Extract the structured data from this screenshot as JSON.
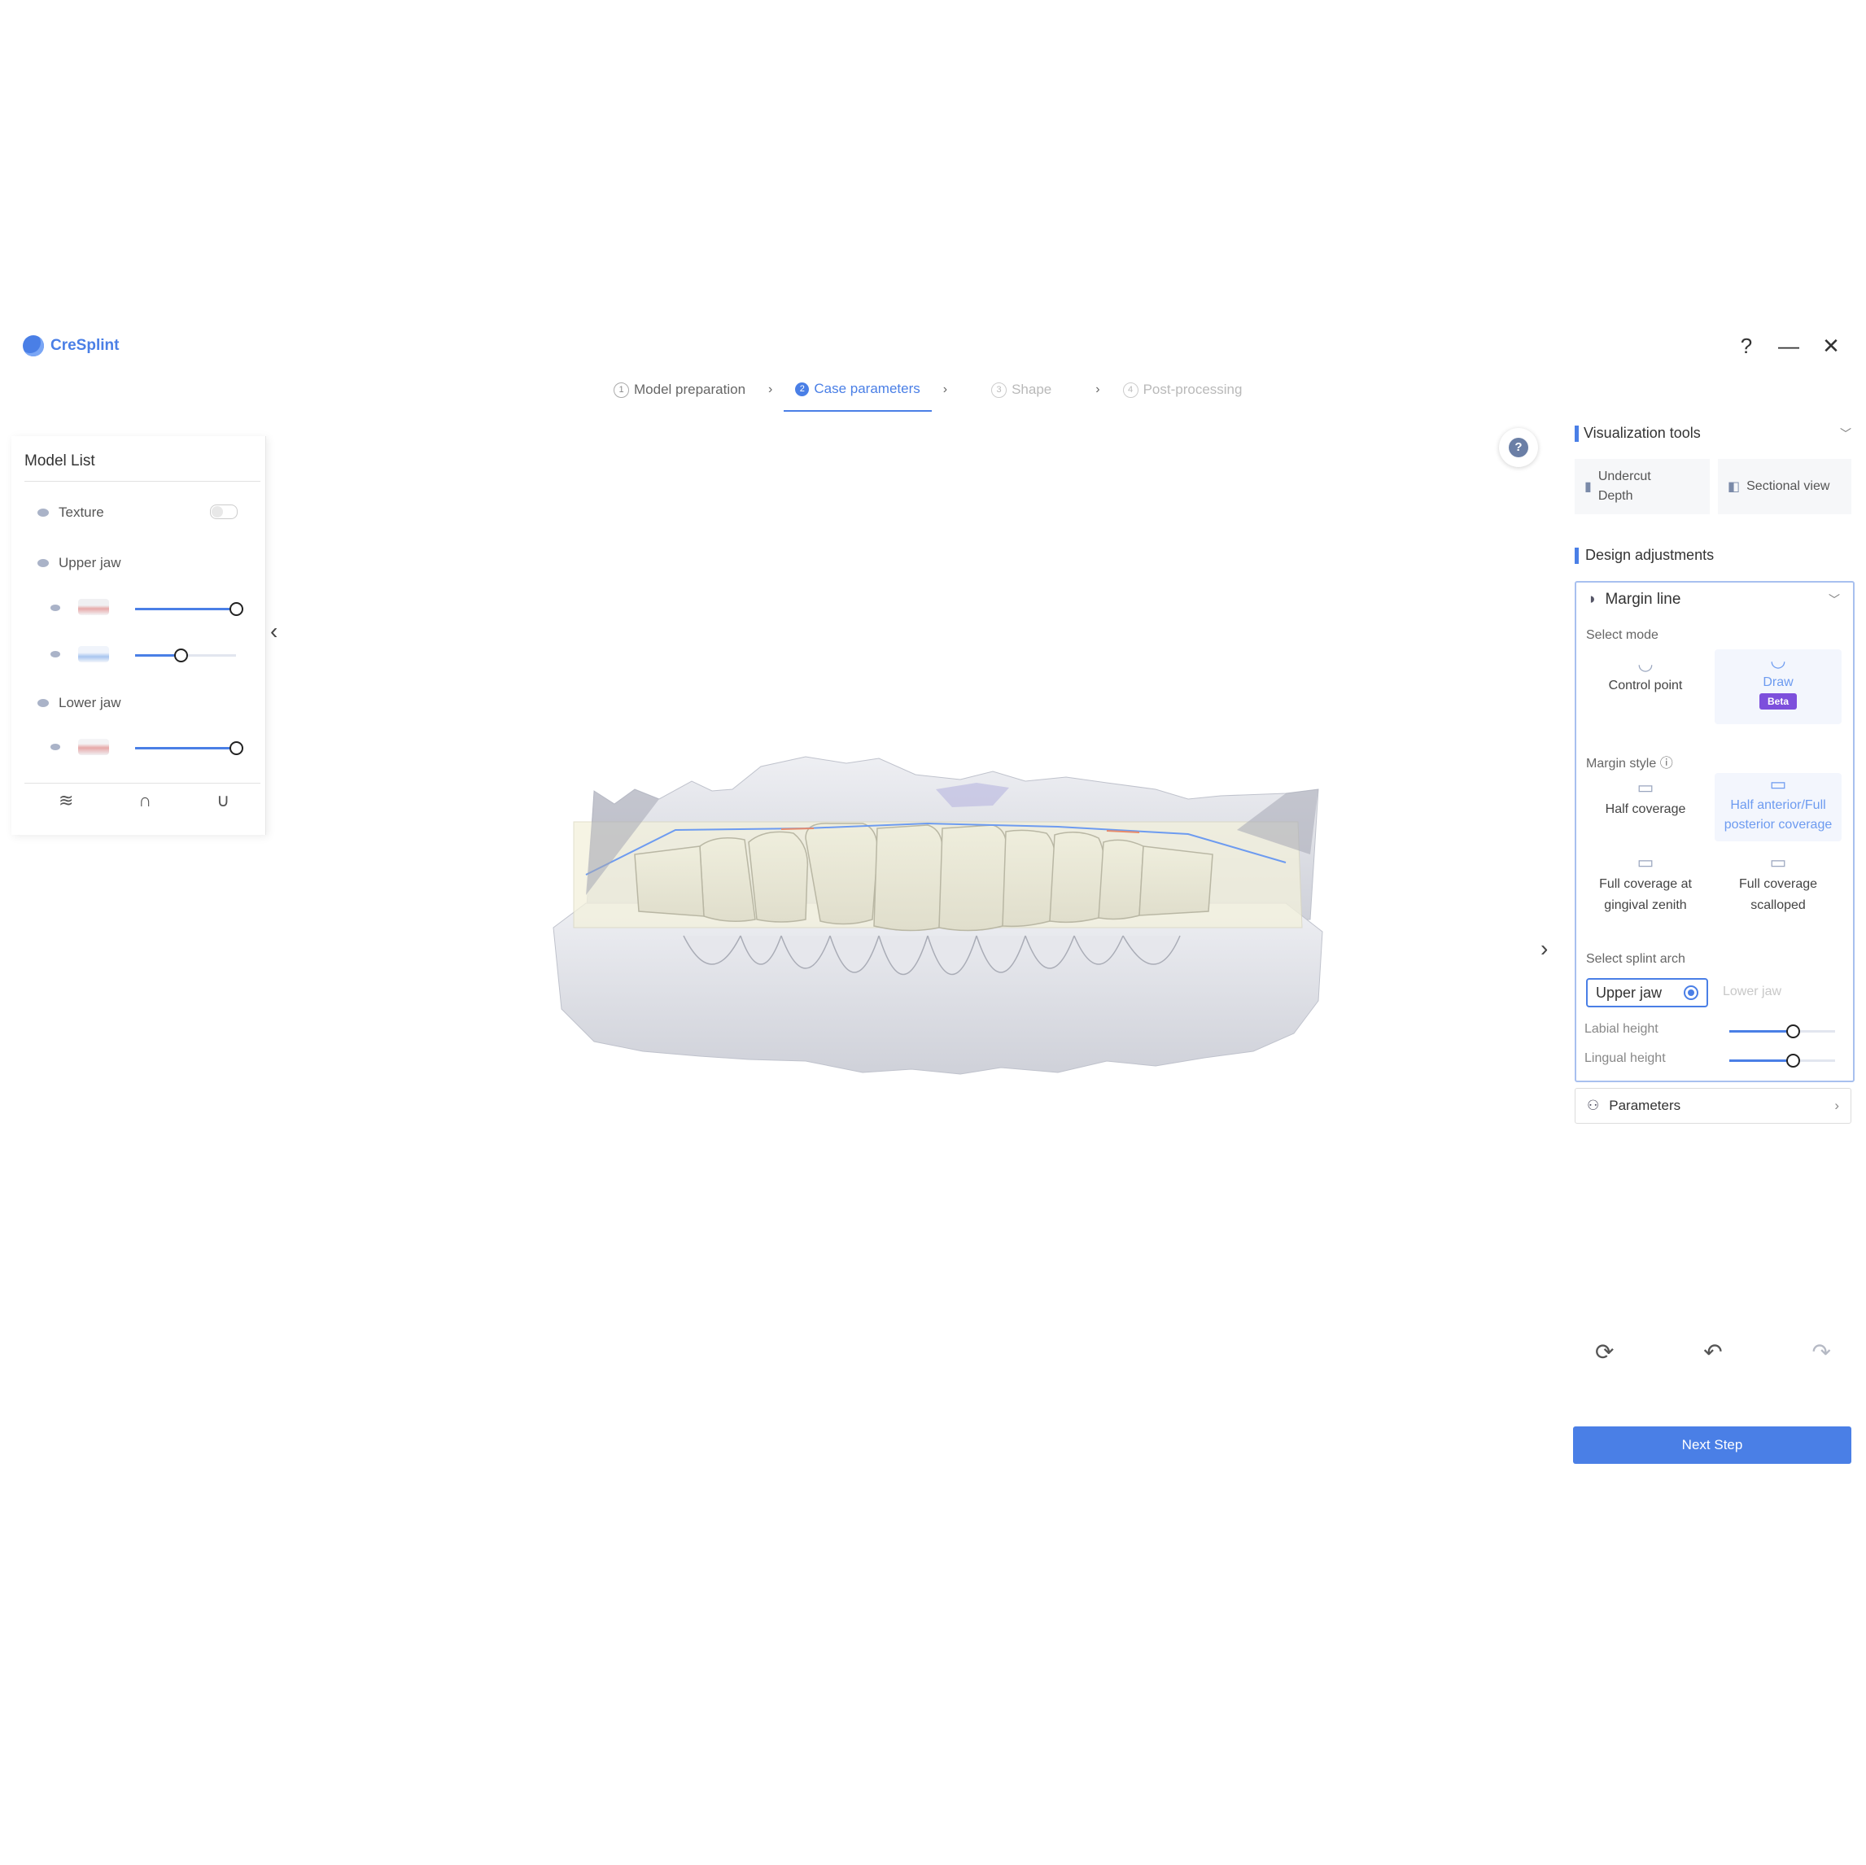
{
  "app": {
    "name": "CreSplint",
    "logo_icon": "logo-icon"
  },
  "window": {
    "help": "?",
    "minimize": "—",
    "close": "✕"
  },
  "steps": [
    {
      "num": "1",
      "label": "Model preparation",
      "state": "done"
    },
    {
      "num": "2",
      "label": "Case parameters",
      "state": "active"
    },
    {
      "num": "3",
      "label": "Shape",
      "state": "future"
    },
    {
      "num": "4",
      "label": "Post-processing",
      "state": "future"
    }
  ],
  "model_list": {
    "title": "Model List",
    "texture_label": "Texture",
    "texture_on": false,
    "upper_jaw_label": "Upper jaw",
    "lower_jaw_label": "Lower jaw",
    "upper_layers": [
      {
        "opacity": 1.0
      },
      {
        "opacity": 0.45
      }
    ],
    "lower_layers": [
      {
        "opacity": 1.0
      }
    ],
    "view_icons": [
      "occlusal-view-icon",
      "upper-arch-icon",
      "lower-arch-icon"
    ]
  },
  "visualization": {
    "title": "Visualization tools",
    "undercut_label": "Undercut\nDepth",
    "sectional_label": "Sectional view"
  },
  "design": {
    "title": "Design adjustments",
    "margin_line": "Margin line",
    "select_mode": "Select mode",
    "mode_control": "Control point",
    "mode_draw": "Draw",
    "beta": "Beta",
    "margin_style": "Margin style ⓘ",
    "style_half": "Half coverage",
    "style_half_anterior": "Half anterior/Full posterior coverage",
    "style_full_zenith": "Full coverage at gingival zenith",
    "style_full_scalloped": "Full coverage scalloped",
    "select_arch": "Select splint arch",
    "arch_upper": "Upper jaw",
    "arch_lower": "Lower jaw",
    "labial_height": "Labial height",
    "lingual_height": "Lingual height",
    "labial_value": 0.6,
    "lingual_value": 0.6,
    "parameters": "Parameters"
  },
  "actions": {
    "reset": "reset-icon",
    "undo": "undo-icon",
    "redo": "redo-icon"
  },
  "next_step": "Next Step",
  "colors": {
    "accent": "#4a7fe6",
    "beta": "#7d4fdc",
    "teeth": "#e8e6cf",
    "gum": "#d4d5dc"
  }
}
